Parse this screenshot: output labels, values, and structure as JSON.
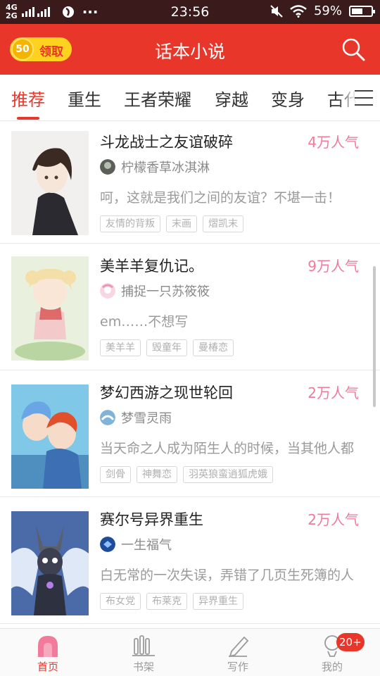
{
  "status_bar": {
    "net_top": "4G",
    "net_bottom": "2G",
    "dots": "···",
    "time": "23:56",
    "battery": "59%",
    "battery_level": 0.59
  },
  "header": {
    "coin_value": "50",
    "claim_label": "领取",
    "title": "话本小说",
    "search_icon": "search-icon",
    "accent_color": "#e8372a"
  },
  "tabs": [
    {
      "label": "推荐",
      "active": true
    },
    {
      "label": "重生"
    },
    {
      "label": "王者荣耀"
    },
    {
      "label": "穿越"
    },
    {
      "label": "变身"
    },
    {
      "label": "古代"
    }
  ],
  "books": [
    {
      "title": "斗龙战士之友谊破碎",
      "popularity": "4万人气",
      "author": "柠檬香草冰淇淋",
      "desc": "呵，这就是我们之间的友谊？不堪一击！",
      "tags": [
        "友情的背叛",
        "末画",
        "熠凯末"
      ]
    },
    {
      "title": "美羊羊复仇记。",
      "popularity": "9万人气",
      "author": "捕捉一只苏筱筱",
      "desc": "em……不想写",
      "tags": [
        "美羊羊",
        "毁童年",
        "曼椿恋"
      ]
    },
    {
      "title": "梦幻西游之现世轮回",
      "popularity": "2万人气",
      "author": "梦雪灵雨",
      "desc": "当天命之人成为陌生人的时候，当其他人都",
      "tags": [
        "剑骨",
        "神舞恋",
        "羽英狼蛮逍狐虎娥"
      ]
    },
    {
      "title": "赛尔号异界重生",
      "popularity": "2万人气",
      "author": "一生福气",
      "desc": "白无常的一次失误，弄错了几页生死簿的人",
      "tags": [
        "布女党",
        "布莱克",
        "异界重生"
      ]
    }
  ],
  "bottom_nav": [
    {
      "label": "首页",
      "icon": "home-icon",
      "active": true
    },
    {
      "label": "书架",
      "icon": "bookshelf-icon"
    },
    {
      "label": "写作",
      "icon": "pen-icon"
    },
    {
      "label": "我的",
      "icon": "profile-icon",
      "badge": "20+"
    }
  ]
}
